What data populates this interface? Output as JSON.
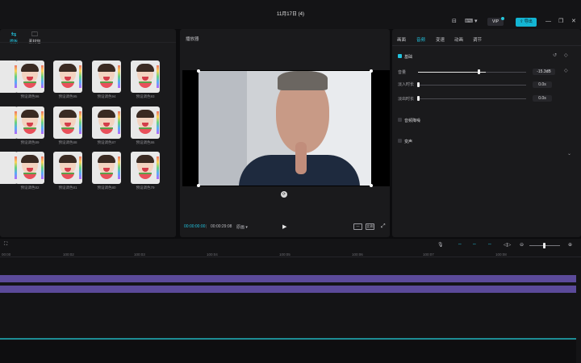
{
  "window": {
    "title": "11月17日 (4)",
    "vip_label": "VIP",
    "export_label": "导出"
  },
  "left_panel": {
    "tabs": [
      {
        "label": "模板",
        "icon": "sliders-icon"
      },
      {
        "label": "素材包",
        "icon": "folder-icon"
      }
    ],
    "thumbnails": [
      [
        "预设调色96",
        "预设调色95",
        "预设调色94",
        "预设调色93"
      ],
      [
        "预设调色89",
        "预设调色88",
        "预设调色87",
        "预设调色86"
      ],
      [
        "预设调色82",
        "预设调色81",
        "预设调色80",
        "预设调色79"
      ]
    ]
  },
  "player": {
    "title": "播放器",
    "time_current": "00:00:00:00",
    "time_total": "00:00:29:08",
    "ratio_label": "原画",
    "ratio_btn": "比例"
  },
  "right_panel": {
    "tabs": [
      "画面",
      "音频",
      "变速",
      "动画",
      "调节"
    ],
    "active_tab": "音频",
    "section_basic": "基础",
    "volume_label": "音量",
    "volume_value": "-15.3dB",
    "volume_level": 0.45,
    "fade_in_label": "淡入时长",
    "fade_in_value": "0.0s",
    "fade_out_label": "淡出时长",
    "fade_out_value": "0.0s",
    "noise_label": "音频降噪",
    "voice_label": "变声"
  },
  "timeline": {
    "ruler": [
      "00:00",
      "100:02",
      "100:03",
      "100:04",
      "100:05",
      "100:06",
      "100:07",
      "100:08"
    ],
    "colors": {
      "video_track": "#5b4a9a",
      "audio_track": "#1d8c94",
      "accent": "#22c3df"
    }
  }
}
